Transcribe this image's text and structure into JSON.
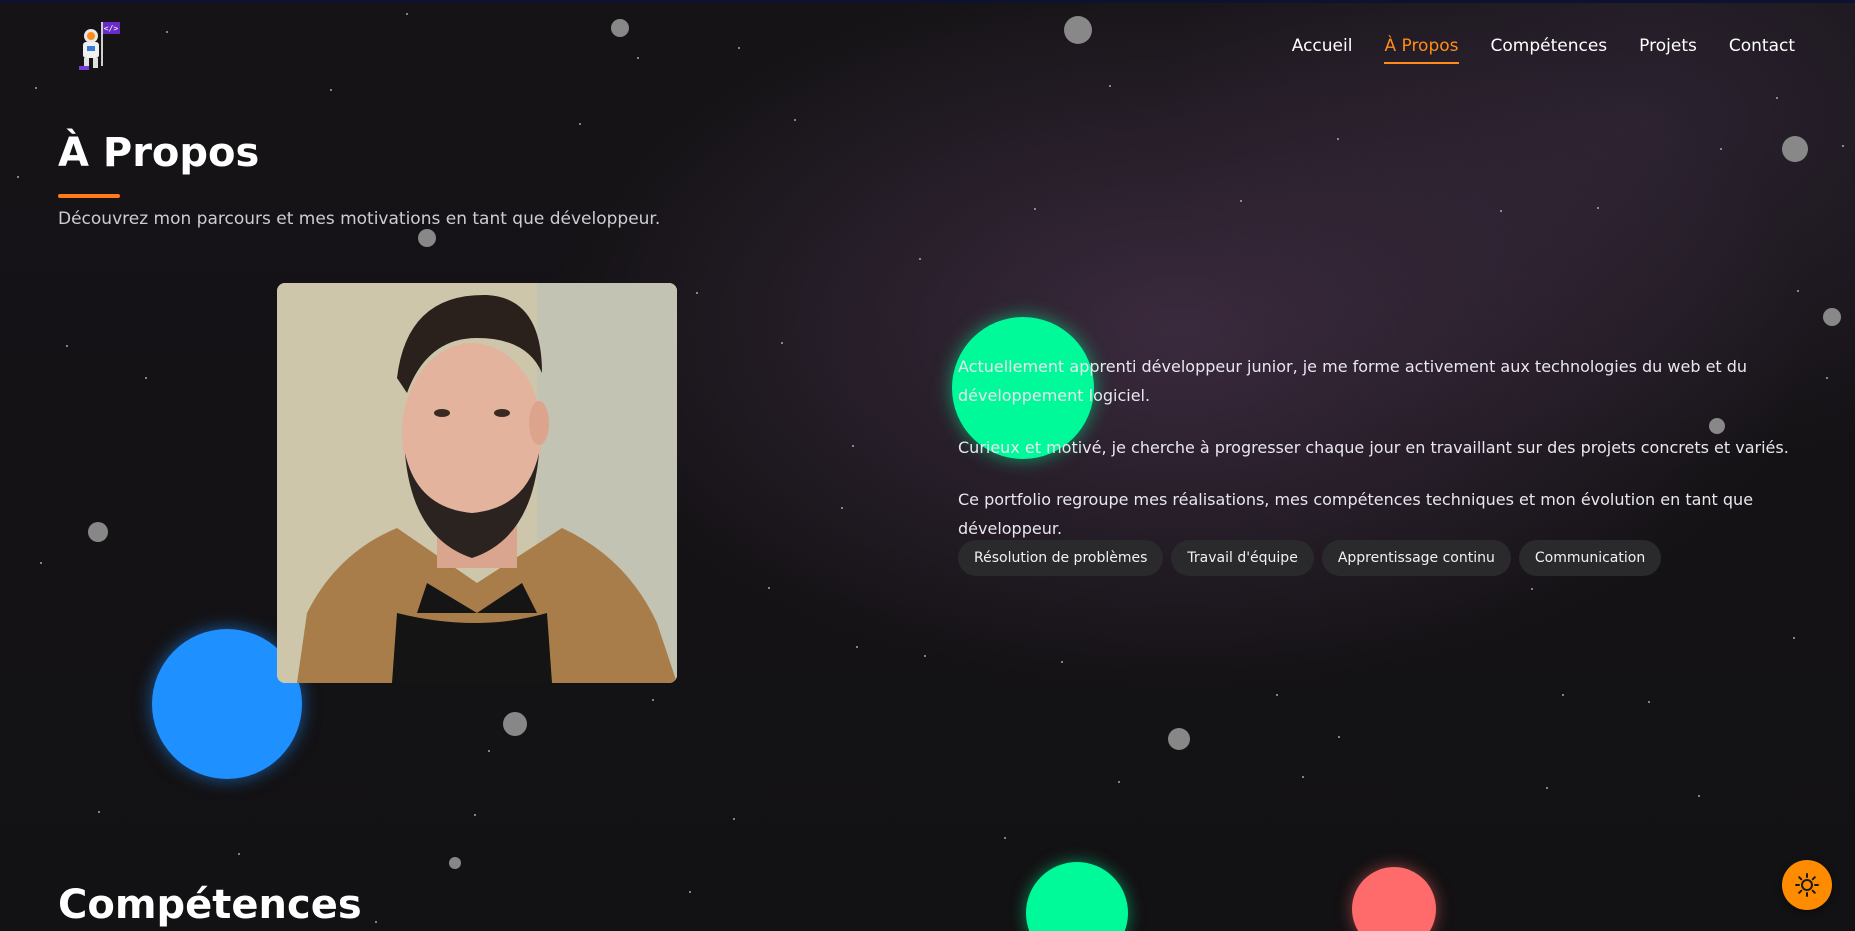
{
  "nav": {
    "items": [
      {
        "label": "Accueil",
        "active": false
      },
      {
        "label": "À Propos",
        "active": true
      },
      {
        "label": "Compétences",
        "active": false
      },
      {
        "label": "Projets",
        "active": false
      },
      {
        "label": "Contact",
        "active": false
      }
    ]
  },
  "logo": {
    "icon": "astronaut-code-flag-icon",
    "flag_text": "</>"
  },
  "about": {
    "title": "À Propos",
    "subtitle": "Découvrez mon parcours et mes motivations en tant que développeur.",
    "photo_icon": "profile-photo",
    "paragraphs": [
      "Actuellement apprenti développeur junior, je me forme activement aux technologies du web et du développement logiciel.",
      "Curieux et motivé, je cherche à progresser chaque jour en travaillant sur des projets concrets et variés.",
      "Ce portfolio regroupe mes réalisations, mes compétences techniques et mon évolution en tant que développeur."
    ],
    "tags": [
      "Résolution de problèmes",
      "Travail d'équipe",
      "Apprentissage continu",
      "Communication"
    ]
  },
  "next_section": {
    "title": "Compétences"
  },
  "theme_toggle": {
    "icon": "sun-icon"
  },
  "colors": {
    "accent": "#ff8c1a",
    "background": "#121113",
    "tag_bg": "#2a292c",
    "bubble_blue": "#1e90ff",
    "bubble_green": "#00fa9a",
    "bubble_red": "#ff6b6b",
    "planet_gray": "#8e8e8e"
  }
}
